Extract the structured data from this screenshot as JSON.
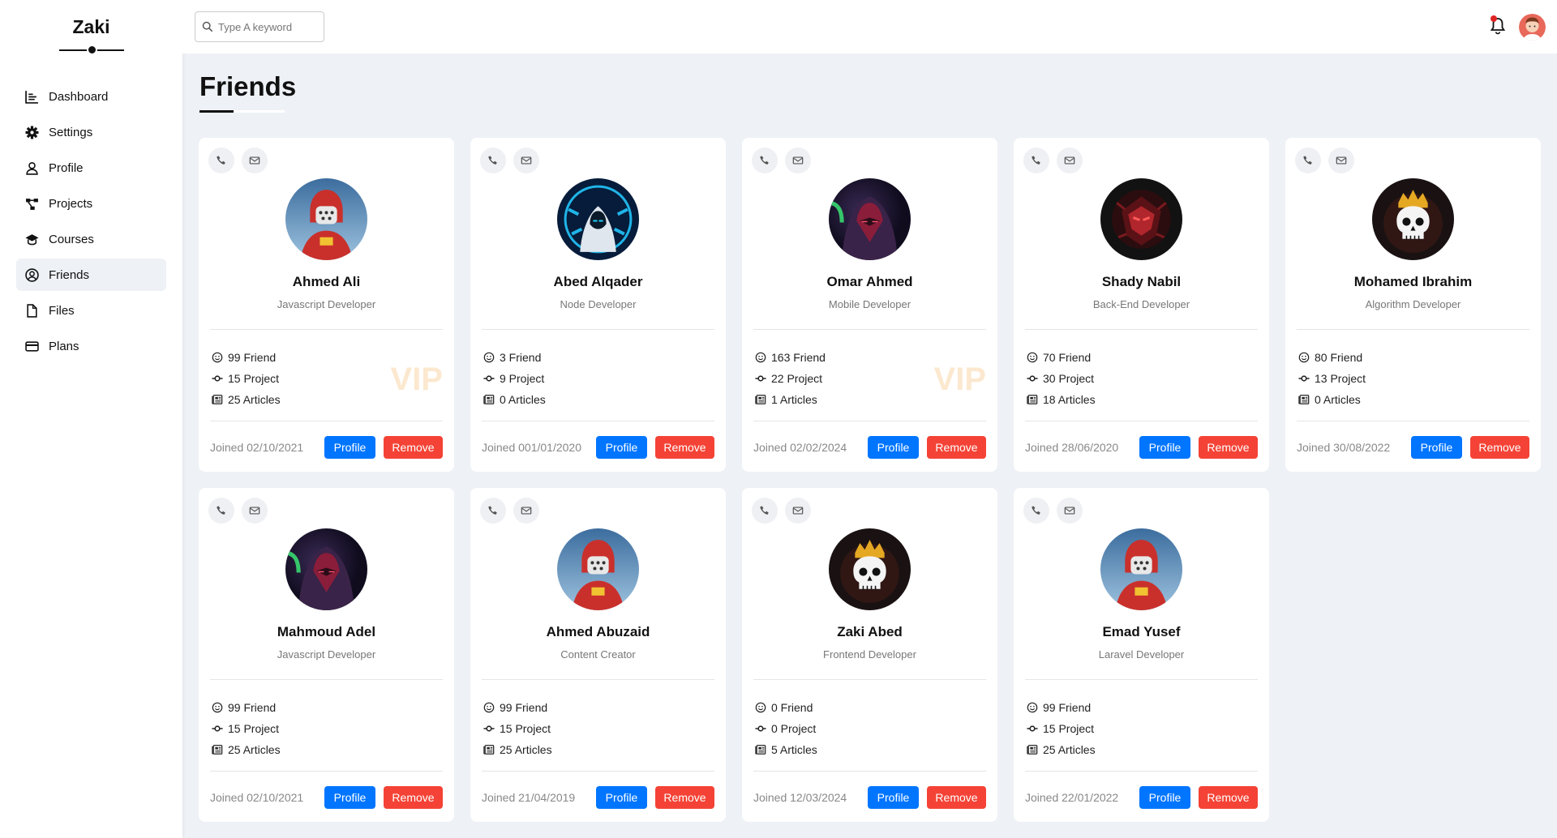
{
  "brand": "Zaki",
  "nav": [
    {
      "label": "Dashboard",
      "icon": "chart-icon"
    },
    {
      "label": "Settings",
      "icon": "gear-icon"
    },
    {
      "label": "Profile",
      "icon": "user-icon"
    },
    {
      "label": "Projects",
      "icon": "diagram-icon"
    },
    {
      "label": "Courses",
      "icon": "graduation-cap-icon"
    },
    {
      "label": "Friends",
      "icon": "user-circle-icon",
      "active": true
    },
    {
      "label": "Files",
      "icon": "file-icon"
    },
    {
      "label": "Plans",
      "icon": "credit-card-icon"
    }
  ],
  "search": {
    "placeholder": "Type A keyword"
  },
  "page_title": "Friends",
  "buttons": {
    "profile": "Profile",
    "remove": "Remove"
  },
  "vip_label": "VIP",
  "friends": [
    {
      "name": "Ahmed Ali",
      "role": "Javascript Developer",
      "friends": "99 Friend",
      "projects": "15 Project",
      "articles": "25 Articles",
      "joined": "Joined 02/10/2021",
      "vip": true,
      "avatar": "red-robot"
    },
    {
      "name": "Abed Alqader",
      "role": "Node Developer",
      "friends": "3 Friend",
      "projects": "9 Project",
      "articles": "0 Articles",
      "joined": "Joined 001/01/2020",
      "vip": false,
      "avatar": "blue-hood"
    },
    {
      "name": "Omar Ahmed",
      "role": "Mobile Developer",
      "friends": "163 Friend",
      "projects": "22 Project",
      "articles": "1 Articles",
      "joined": "Joined 02/02/2024",
      "vip": true,
      "avatar": "purple-hood"
    },
    {
      "name": "Shady Nabil",
      "role": "Back-End Developer",
      "friends": "70 Friend",
      "projects": "30 Project",
      "articles": "18 Articles",
      "joined": "Joined 28/06/2020",
      "vip": false,
      "avatar": "red-mask"
    },
    {
      "name": "Mohamed Ibrahim",
      "role": "Algorithm Developer",
      "friends": "80 Friend",
      "projects": "13 Project",
      "articles": "0 Articles",
      "joined": "Joined 30/08/2022",
      "vip": false,
      "avatar": "crown-skull"
    },
    {
      "name": "Mahmoud Adel",
      "role": "Javascript Developer",
      "friends": "99 Friend",
      "projects": "15 Project",
      "articles": "25 Articles",
      "joined": "Joined 02/10/2021",
      "vip": false,
      "avatar": "purple-hood"
    },
    {
      "name": "Ahmed Abuzaid",
      "role": "Content Creator",
      "friends": "99 Friend",
      "projects": "15 Project",
      "articles": "25 Articles",
      "joined": "Joined 21/04/2019",
      "vip": false,
      "avatar": "red-robot"
    },
    {
      "name": "Zaki Abed",
      "role": "Frontend Developer",
      "friends": "0 Friend",
      "projects": "0 Project",
      "articles": "5 Articles",
      "joined": "Joined 12/03/2024",
      "vip": false,
      "avatar": "crown-skull"
    },
    {
      "name": "Emad Yusef",
      "role": "Laravel Developer",
      "friends": "99 Friend",
      "projects": "15 Project",
      "articles": "25 Articles",
      "joined": "Joined 22/01/2022",
      "vip": false,
      "avatar": "red-robot"
    }
  ]
}
